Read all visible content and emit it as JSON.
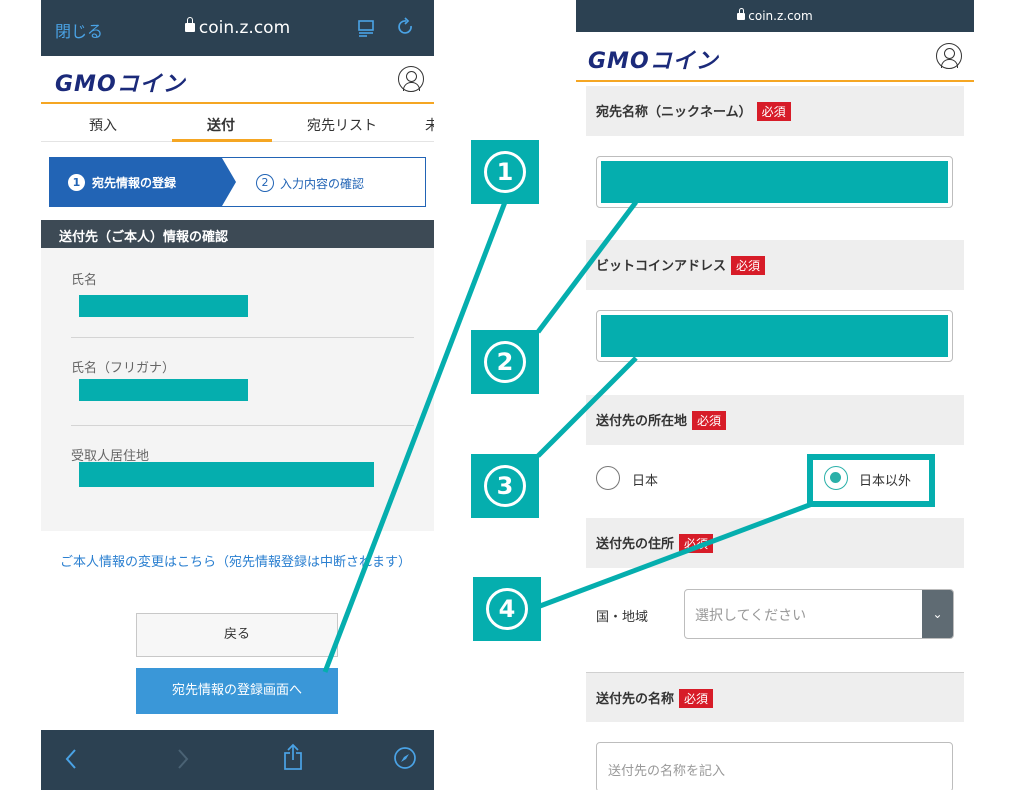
{
  "left_phone": {
    "browser": {
      "close_label": "閉じる",
      "url": "coin.z.com"
    },
    "brand": {
      "logo_text": "GMOコイン"
    },
    "tabs": [
      {
        "label": "預入"
      },
      {
        "label": "送付",
        "active": true
      },
      {
        "label": "宛先リスト"
      },
      {
        "label": "未"
      }
    ],
    "steps": [
      {
        "number": "1",
        "label": "宛先情報の登録",
        "active": true
      },
      {
        "number": "2",
        "label": "入力内容の確認",
        "active": false
      }
    ],
    "section_title": "送付先（ご本人）情報の確認",
    "info_labels": {
      "name": "氏名",
      "name_kana": "氏名（フリガナ）",
      "address": "受取人居住地"
    },
    "change_link": "ご本人情報の変更はこちら（宛先情報登録は中断されます）",
    "back_button": "戻る",
    "register_button": "宛先情報の登録画面へ"
  },
  "right_phone": {
    "browser": {
      "url": "coin.z.com"
    },
    "brand": {
      "logo_text": "GMOコイン"
    },
    "required_label": "必須",
    "fields": {
      "nickname_label": "宛先名称（ニックネーム）",
      "btc_address_label": "ビットコインアドレス",
      "location_label": "送付先の所在地",
      "location_option_japan": "日本",
      "location_option_other": "日本以外",
      "location_selected": "日本以外",
      "address_label": "送付先の住所",
      "country_label": "国・地域",
      "country_placeholder": "選択してください",
      "recipient_name_label": "送付先の名称",
      "recipient_name_placeholder": "送付先の名称を記入"
    }
  },
  "annotations": {
    "badges": [
      "1",
      "2",
      "3",
      "4"
    ],
    "color": "#05aeae"
  },
  "colors": {
    "browser_bar": "#2c4152",
    "brand_navy": "#1b2a7a",
    "accent_orange": "#f5a623",
    "step_blue": "#2264b5",
    "button_blue": "#3a97d8",
    "required_red": "#d71c28",
    "redaction_teal": "#05aeae"
  }
}
